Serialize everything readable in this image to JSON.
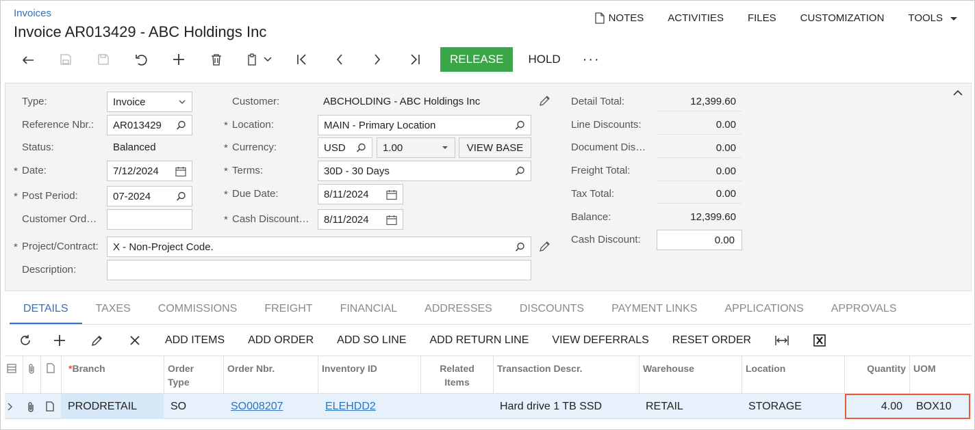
{
  "header": {
    "breadcrumb": "Invoices",
    "title": "Invoice AR013429 - ABC Holdings Inc",
    "menu": {
      "notes": "NOTES",
      "activities": "ACTIVITIES",
      "files": "FILES",
      "customization": "CUSTOMIZATION",
      "tools": "TOOLS"
    }
  },
  "toolbar": {
    "release": "RELEASE",
    "hold": "HOLD",
    "more": "···"
  },
  "form": {
    "type_label": "Type:",
    "type_value": "Invoice",
    "refnbr_label": "Reference Nbr.:",
    "refnbr_value": "AR013429",
    "status_label": "Status:",
    "status_value": "Balanced",
    "date_label": "Date:",
    "date_value": "7/12/2024",
    "postperiod_label": "Post Period:",
    "postperiod_value": "07-2024",
    "custord_label": "Customer Ord…",
    "custord_value": "",
    "project_label": "Project/Contract:",
    "project_value": "X - Non-Project Code.",
    "description_label": "Description:",
    "description_value": "",
    "customer_label": "Customer:",
    "customer_value": "ABCHOLDING - ABC Holdings Inc",
    "location_label": "Location:",
    "location_value": "MAIN - Primary Location",
    "currency_label": "Currency:",
    "currency_value": "USD",
    "rate_value": "1.00",
    "viewbase": "VIEW BASE",
    "terms_label": "Terms:",
    "terms_value": "30D - 30 Days",
    "duedate_label": "Due Date:",
    "duedate_value": "8/11/2024",
    "cashdisc_label": "Cash Discount…",
    "cashdisc_value": "8/11/2024"
  },
  "totals": {
    "detail_label": "Detail Total:",
    "detail_value": "12,399.60",
    "linedisc_label": "Line Discounts:",
    "linedisc_value": "0.00",
    "docdisc_label": "Document Dis…",
    "docdisc_value": "0.00",
    "freight_label": "Freight Total:",
    "freight_value": "0.00",
    "tax_label": "Tax Total:",
    "tax_value": "0.00",
    "balance_label": "Balance:",
    "balance_value": "12,399.60",
    "cashdiscount_label": "Cash Discount:",
    "cashdiscount_value": "0.00"
  },
  "tabs": [
    "DETAILS",
    "TAXES",
    "COMMISSIONS",
    "FREIGHT",
    "FINANCIAL",
    "ADDRESSES",
    "DISCOUNTS",
    "PAYMENT LINKS",
    "APPLICATIONS",
    "APPROVALS"
  ],
  "grid_toolbar": {
    "add_items": "ADD ITEMS",
    "add_order": "ADD ORDER",
    "add_so_line": "ADD SO LINE",
    "add_return_line": "ADD RETURN LINE",
    "view_deferrals": "VIEW DEFERRALS",
    "reset_order": "RESET ORDER"
  },
  "grid": {
    "columns": {
      "branch": "Branch",
      "order_type_1": "Order",
      "order_type_2": "Type",
      "order_nbr": "Order Nbr.",
      "inventory_id": "Inventory ID",
      "related_1": "Related",
      "related_2": "Items",
      "trans_descr": "Transaction Descr.",
      "warehouse": "Warehouse",
      "location": "Location",
      "quantity": "Quantity",
      "uom": "UOM"
    },
    "row": {
      "branch": "PRODRETAIL",
      "order_type": "SO",
      "order_nbr": "SO008207",
      "inventory_id": "ELEHDD2",
      "related": "",
      "trans_descr": "Hard drive 1 TB SSD",
      "warehouse": "RETAIL",
      "location": "STORAGE",
      "quantity": "4.00",
      "uom": "BOX10"
    }
  },
  "colors": {
    "accent": "#2f71c2",
    "release": "#3aa648",
    "highlight": "#e35d3a",
    "selected_row": "#e6f1fb"
  }
}
